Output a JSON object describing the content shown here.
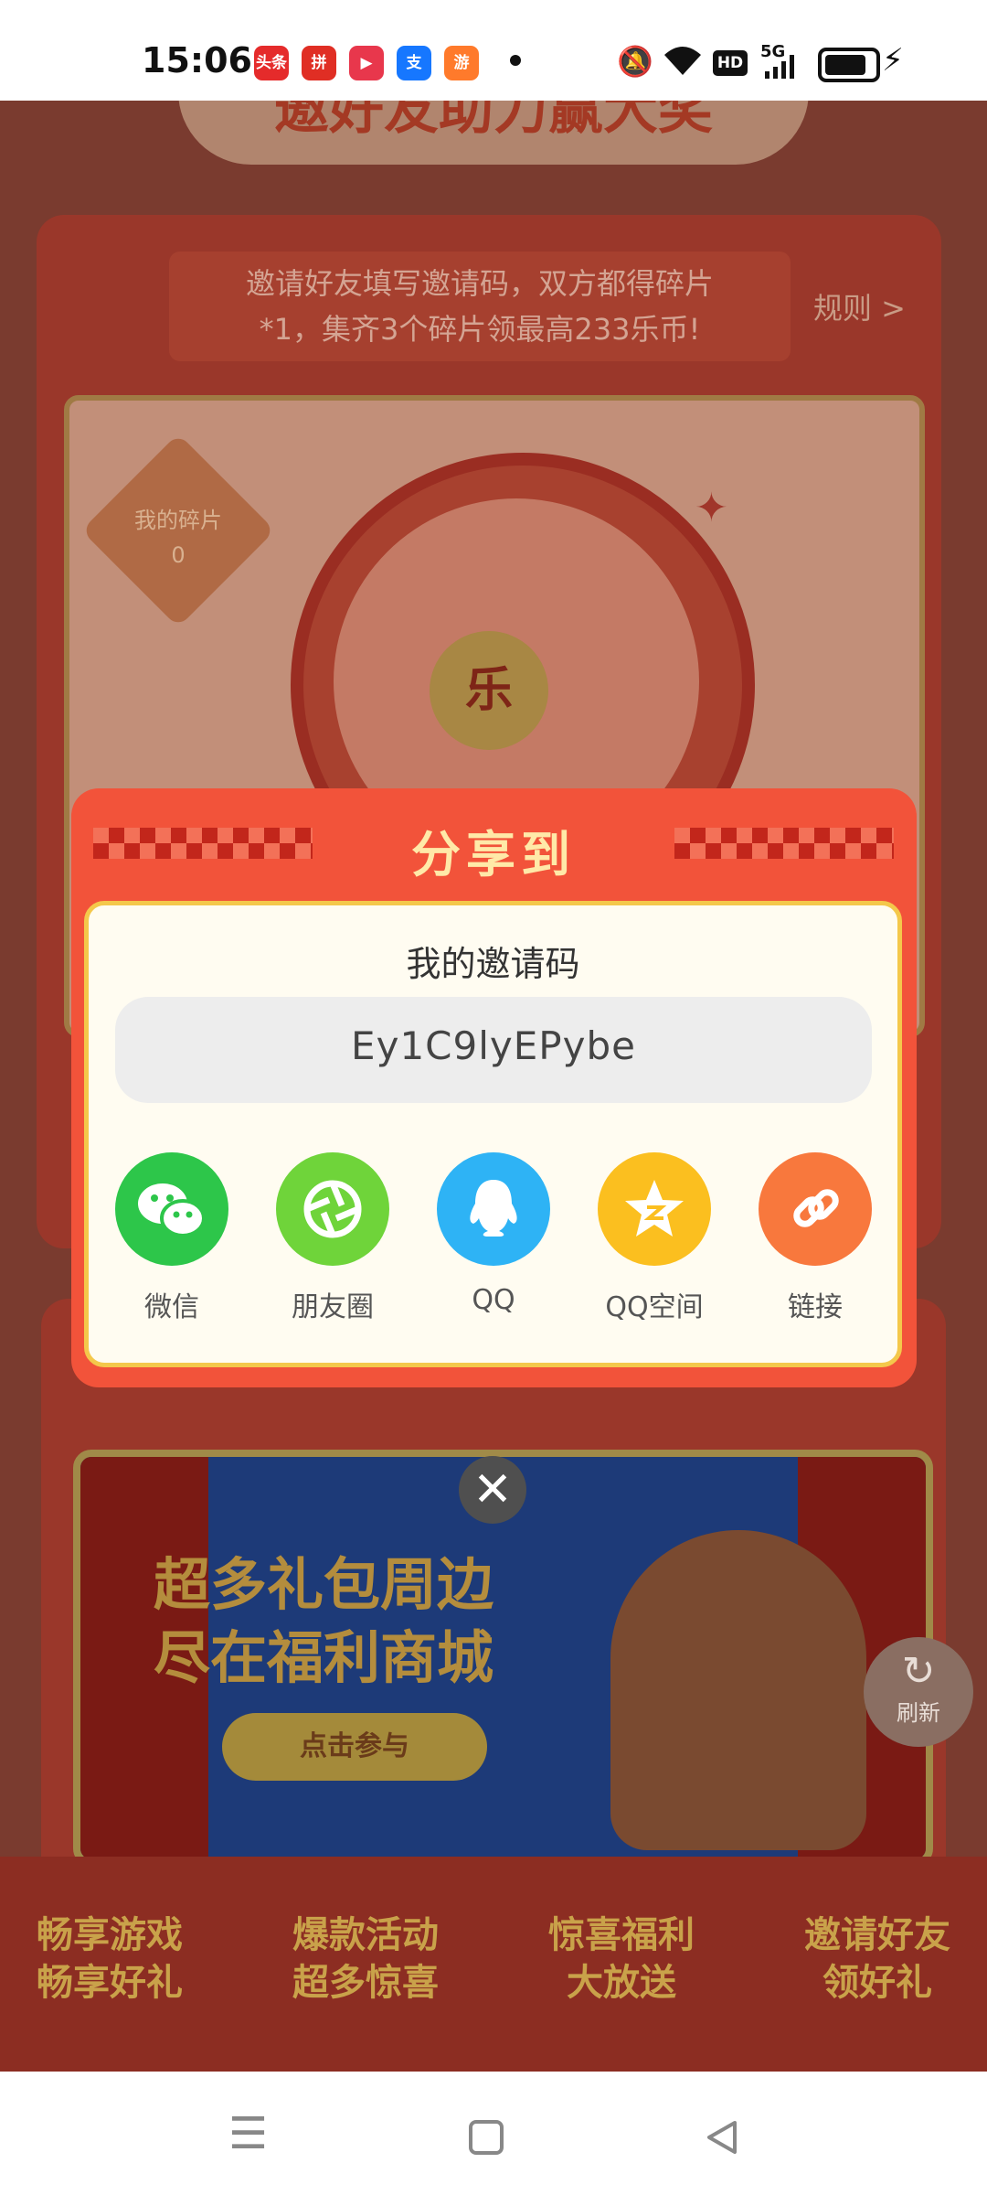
{
  "status_bar": {
    "time": "15:06",
    "app_icons": [
      {
        "name": "toutiao-icon",
        "text": "头条",
        "color": "#e52b2b"
      },
      {
        "name": "pinduoduo-icon",
        "text": "拼",
        "color": "#e02e24"
      },
      {
        "name": "video-icon",
        "text": "▶",
        "color": "#e8374c"
      },
      {
        "name": "alipay-icon",
        "text": "支",
        "color": "#1677ff"
      },
      {
        "name": "game-store-icon",
        "text": "游",
        "color": "#ff7a2b"
      }
    ],
    "network": "5G",
    "hd_label": "HD"
  },
  "background_page": {
    "title": "邀好友助力赢大奖",
    "rule_text_line1": "邀请好友填写邀请码，双方都得碎片",
    "rule_text_line2": "*1，集齐3个碎片领最高233乐币!",
    "rules_link": "规则 >",
    "shards_label": "我的碎片",
    "shards_count": "0",
    "wheel_center": "乐",
    "banner_line1": "超多礼包周边",
    "banner_line2": "尽在福利商城",
    "banner_button": "点击参与",
    "refresh_label": "刷新",
    "footer_items": [
      {
        "line1": "畅享游戏",
        "line2": "畅享好礼"
      },
      {
        "line1": "爆款活动",
        "line2": "超多惊喜"
      },
      {
        "line1": "惊喜福利",
        "line2": "大放送"
      },
      {
        "line1": "邀请好友",
        "line2": "领好礼"
      }
    ]
  },
  "share_dialog": {
    "title": "分享到",
    "code_label": "我的邀请码",
    "invite_code": "Ey1C9lyEPybe",
    "targets": [
      {
        "label": "微信",
        "icon": "wechat-icon",
        "color": "#2dc64a"
      },
      {
        "label": "朋友圈",
        "icon": "moments-icon",
        "color": "#6fd43a"
      },
      {
        "label": "QQ",
        "icon": "qq-icon",
        "color": "#2eb3f5"
      },
      {
        "label": "QQ空间",
        "icon": "qzone-icon",
        "color": "#fbbf1f"
      },
      {
        "label": "链接",
        "icon": "link-icon",
        "color": "#f8783d"
      }
    ]
  }
}
